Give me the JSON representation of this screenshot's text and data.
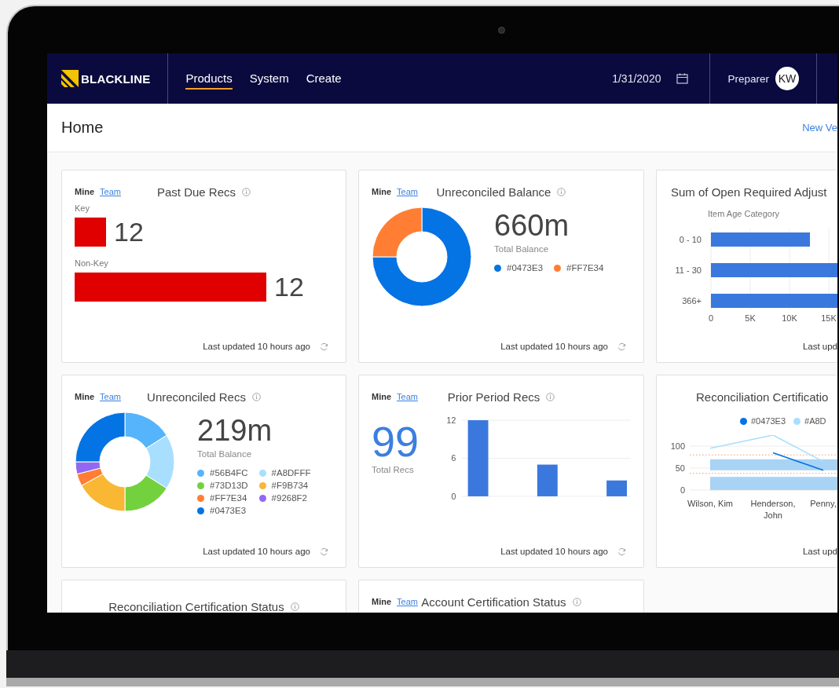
{
  "nav": {
    "brand": "BLACKLINE",
    "tabs": [
      {
        "label": "Products",
        "selected": true
      },
      {
        "label": "System",
        "selected": false
      },
      {
        "label": "Create",
        "selected": false
      }
    ],
    "date": "1/31/2020",
    "role": "Preparer",
    "avatar": "KW"
  },
  "page": {
    "title": "Home",
    "action": "New Ve"
  },
  "cards": [
    {
      "kind": "bars",
      "scope": [
        {
          "label": "Mine",
          "selected": true
        },
        {
          "label": "Team",
          "selected": false
        }
      ],
      "title": "Past Due Recs",
      "rows": [
        {
          "label": "Key",
          "value": "12"
        },
        {
          "label": "Non-Key",
          "value": "12"
        }
      ],
      "footer": "Last updated 10 hours ago"
    },
    {
      "kind": "donut",
      "scope": [
        {
          "label": "Mine",
          "selected": true
        },
        {
          "label": "Team",
          "selected": false
        }
      ],
      "title": "Unreconciled Balance",
      "total": "660m",
      "total_label": "Total Balance",
      "legend": [
        {
          "label": "#0473E3",
          "color": "#0473e3"
        },
        {
          "label": "#FF7E34",
          "color": "#ff7e34"
        }
      ],
      "footer": "Last updated 10 hours ago"
    },
    {
      "kind": "hbar",
      "title": "Sum of Open Required Adjust",
      "axis_title": "Item Age Category",
      "categories": [
        "0 - 10",
        "11 - 30",
        "366+"
      ],
      "ticks": [
        "0",
        "5K",
        "10K",
        "15K"
      ],
      "footer": "Last upd"
    },
    {
      "kind": "donut",
      "scope": [
        {
          "label": "Mine",
          "selected": true
        },
        {
          "label": "Team",
          "selected": false
        }
      ],
      "title": "Unreconciled Recs",
      "total": "219m",
      "total_label": "Total Balance",
      "legend": [
        {
          "label": "#56B4FC",
          "color": "#56b4fc"
        },
        {
          "label": "#A8DFFF",
          "color": "#a8dfff"
        },
        {
          "label": "#73D13D",
          "color": "#73d13d"
        },
        {
          "label": "#F9B734",
          "color": "#f9b734"
        },
        {
          "label": "#FF7E34",
          "color": "#ff7e34"
        },
        {
          "label": "#9268F2",
          "color": "#9268f2"
        },
        {
          "label": "#0473E3",
          "color": "#0473e3"
        }
      ],
      "footer": "Last updated 10 hours ago"
    },
    {
      "kind": "column",
      "scope": [
        {
          "label": "Mine",
          "selected": true
        },
        {
          "label": "Team",
          "selected": false
        }
      ],
      "title": "Prior Period Recs",
      "total": "99",
      "total_label": "Total Recs",
      "chart_data": {
        "type": "bar",
        "values": [
          12,
          5,
          2.5
        ],
        "ylim": [
          0,
          12
        ],
        "yticks": [
          {
            "value": 0,
            "label": "0"
          },
          {
            "value": 6,
            "label": "6"
          },
          {
            "value": 12,
            "label": "12"
          }
        ]
      },
      "footer": "Last updated 10 hours ago"
    },
    {
      "kind": "area",
      "title": "Reconciliation Certificatio",
      "legend": [
        {
          "label": "#0473E3",
          "color": "#0473e3"
        },
        {
          "label": "#A8D",
          "color": "#a8dfff"
        }
      ],
      "ticks": [
        "100",
        "50",
        "0"
      ],
      "categories": [
        "Wilson, Kim",
        "Henderson, John",
        "Penny,"
      ],
      "footer": "Last upd"
    },
    {
      "kind": "stub",
      "title": "Reconciliation Certification Status"
    },
    {
      "kind": "stub",
      "scope": [
        {
          "label": "Mine",
          "selected": true
        },
        {
          "label": "Team",
          "selected": false
        }
      ],
      "title": "Account Certification Status"
    }
  ]
}
